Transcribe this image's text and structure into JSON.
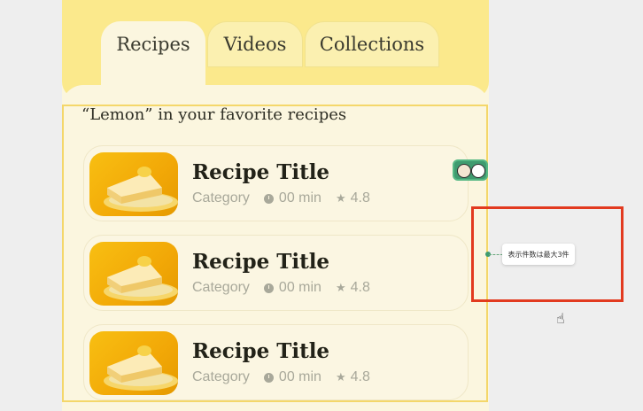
{
  "tabs": [
    {
      "label": "Recipes",
      "active": true
    },
    {
      "label": "Videos",
      "active": false
    },
    {
      "label": "Collections",
      "active": false
    }
  ],
  "search": {
    "heading": "“Lemon” in your favorite recipes"
  },
  "recipes": [
    {
      "title": "Recipe Title",
      "category": "Category",
      "time": "00 min",
      "rating": "4.8",
      "image_icon": "cake-slice-icon"
    },
    {
      "title": "Recipe Title",
      "category": "Category",
      "time": "00 min",
      "rating": "4.8",
      "image_icon": "cake-slice-icon"
    },
    {
      "title": "Recipe Title",
      "category": "Category",
      "time": "00 min",
      "rating": "4.8",
      "image_icon": "cake-slice-icon"
    }
  ],
  "annotation": {
    "note": "表示件数は最大3件"
  },
  "icons": {
    "time": "clock-icon",
    "rating": "star-icon",
    "cursor": "hand-cursor-icon",
    "collaborators": "avatar-icon"
  },
  "colors": {
    "header_yellow": "#fbe98c",
    "card_bg": "#fbf6df",
    "annotation_red": "#e23a1f",
    "collab_green": "#3f9b6f"
  }
}
